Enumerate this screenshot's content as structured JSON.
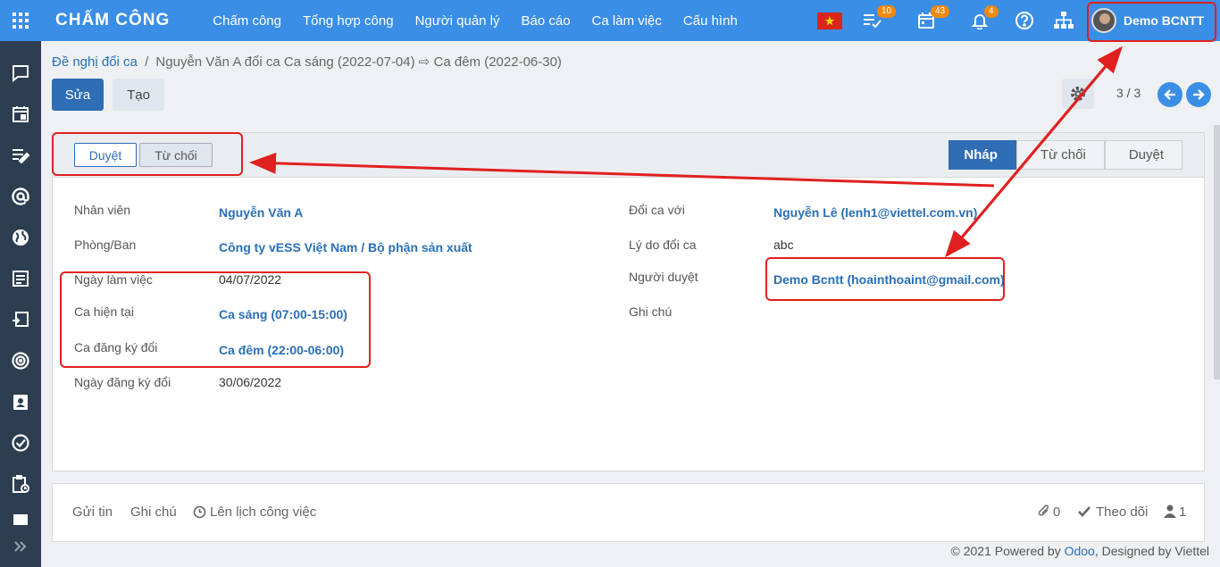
{
  "topbar": {
    "app_title": "CHẤM CÔNG",
    "menu": [
      "Chấm công",
      "Tổng hợp công",
      "Người quản lý",
      "Báo cáo",
      "Ca làm việc",
      "Cấu hình"
    ],
    "badges": {
      "activities": "10",
      "calendar": "43",
      "notifications": "4"
    },
    "user_name": "Demo BCNTT"
  },
  "breadcrumb": {
    "parent": "Đề nghị đổi ca",
    "separator": "/",
    "current": "Nguyễn Văn A đổi ca Ca sáng (2022-07-04) ⇨ Ca đêm (2022-06-30)"
  },
  "buttons": {
    "edit": "Sửa",
    "create": "Tạo"
  },
  "pager": "3 / 3",
  "form_header": {
    "approve": "Duyệt",
    "reject": "Từ chối",
    "stages": [
      "Nháp",
      "Từ chối",
      "Duyệt"
    ],
    "active_stage": "Nháp"
  },
  "form": {
    "left": [
      {
        "label": "Nhân viên",
        "value": "Nguyễn Văn A",
        "link": true
      },
      {
        "label": "Phòng/Ban",
        "value": "Công ty vESS Việt Nam / Bộ phận sản xuất",
        "link": true
      },
      {
        "label": "Ngày làm việc",
        "value": "04/07/2022",
        "link": false
      },
      {
        "label": "Ca hiện tại",
        "value": "Ca sáng (07:00-15:00)",
        "link": true
      },
      {
        "label": "Ca đăng ký đổi",
        "value": "Ca đêm (22:00-06:00)",
        "link": true
      },
      {
        "label": "Ngày đăng ký đổi",
        "value": "30/06/2022",
        "link": false
      }
    ],
    "right": [
      {
        "label": "Đổi ca với",
        "value": "Nguyễn Lê (lenh1@viettel.com.vn)",
        "link": true
      },
      {
        "label": "Lý do đổi ca",
        "value": "abc",
        "link": false
      },
      {
        "label": "Người duyệt",
        "value": "Demo Bcntt (hoainthoaint@gmail.com)",
        "link": true
      },
      {
        "label": "Ghi chú",
        "value": "",
        "link": false
      }
    ]
  },
  "chatter": {
    "send_message": "Gửi tin",
    "log_note": "Ghi chú",
    "schedule": "Lên lịch công việc",
    "attachments": "0",
    "follow": "Theo dõi",
    "followers": "1"
  },
  "footer": {
    "prefix": "© 2021 Powered by ",
    "odoo": "Odoo",
    "suffix": ", Designed by Viettel"
  },
  "colors": {
    "topbar": "#3a8ee6",
    "sidebar": "#2c3e50",
    "primary": "#2f6db5",
    "annotation": "#e02020"
  }
}
